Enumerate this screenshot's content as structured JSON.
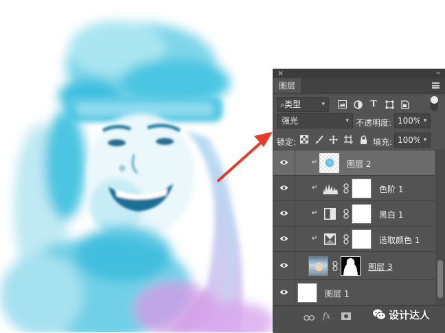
{
  "panel": {
    "tab_label": "图层",
    "close_glyph": "×",
    "collapse_glyph": "‹‹",
    "filter": {
      "kind_label": "类型"
    },
    "blend_mode": "强光",
    "opacity_label": "不透明度:",
    "opacity_value": "100%",
    "lock_label": "锁定:",
    "fill_label": "填充:",
    "fill_value": "100%",
    "layers": [
      {
        "name": "图层 2",
        "selected": true,
        "clipped": true
      },
      {
        "name": "色阶 1",
        "selected": false,
        "clipped": true,
        "adjustment": "levels"
      },
      {
        "name": "黑白 1",
        "selected": false,
        "clipped": true,
        "adjustment": "black-white"
      },
      {
        "name": "选取颜色 1",
        "selected": false,
        "clipped": true,
        "adjustment": "selective-color"
      },
      {
        "name": "图层 3",
        "selected": false,
        "clipped": false,
        "has_mask": true
      },
      {
        "name": "图层 1",
        "selected": false,
        "clipped": false
      }
    ],
    "bottom": {
      "link_icon": "link-icon",
      "fx_label": "fx",
      "mask_icon": "mask-icon"
    }
  },
  "watermark": {
    "text": "设计达人"
  },
  "colors": {
    "panel_bg": "#535353",
    "selected_row": "#6c6c6c",
    "arrow": "#e83a2c",
    "wash_cyan": "#2fc4e0",
    "wash_purple": "#b184e0"
  }
}
